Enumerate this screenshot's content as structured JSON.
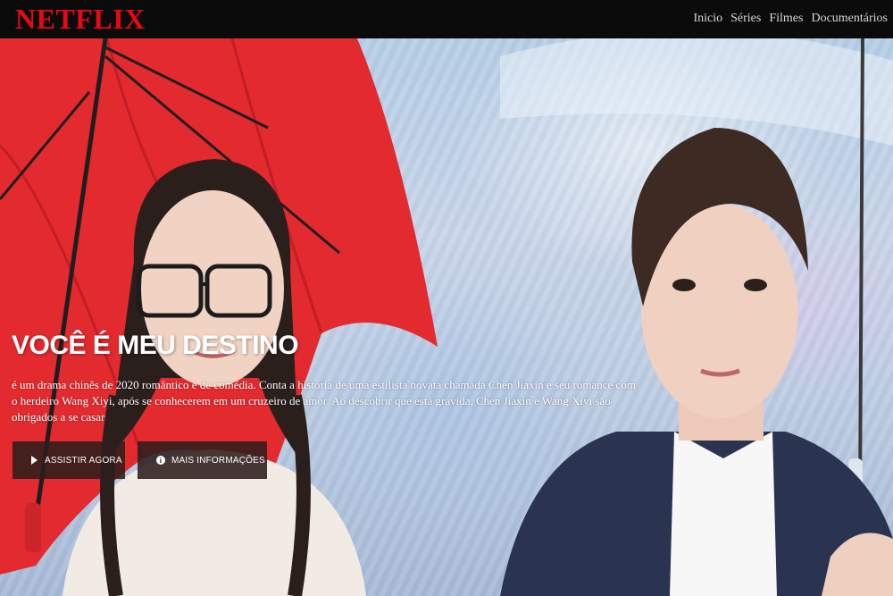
{
  "header": {
    "logo": "NETFLIX",
    "nav": [
      "Inicio",
      "Séries",
      "Filmes",
      "Documentários"
    ]
  },
  "hero": {
    "title": "VOCÊ É MEU DESTINO",
    "description": "é um drama chinês de 2020 romântico e de comédia. Conta a história de uma estilista novata chamada Chen Jiaxin e seu romance com o herdeiro Wang Xiyi, após se conhecerem em um cruzeiro de amor. Ao descobrir que está grávida, Chen Jiaxin e Wang Xiyi são obrigados a se casar",
    "buttons": {
      "play_label": "ASSISTIR AGORA",
      "info_label": "MAIS INFORMAÇÕES"
    }
  },
  "colors": {
    "brand": "#e50914",
    "header_bg": "#0b0b0b",
    "button_bg": "#2d1e1c",
    "umbrella": "#e8242c"
  },
  "icons": [
    "play-icon",
    "info-icon"
  ]
}
